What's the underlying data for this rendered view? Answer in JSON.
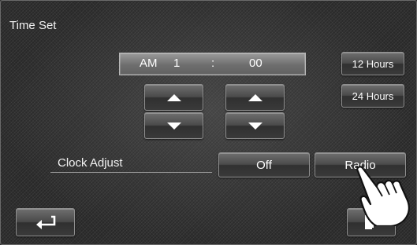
{
  "title": "Time Set",
  "time": {
    "ampm": "AM",
    "hour": "1",
    "separator": ":",
    "minute": "00"
  },
  "format_buttons": {
    "hours12": "12 Hours",
    "hours24": "24 Hours"
  },
  "clock_adjust": {
    "label": "Clock Adjust",
    "options": [
      "Off",
      "Radio"
    ],
    "selected": "Radio"
  },
  "icons": {
    "hour_up": "triangle-up-icon",
    "hour_down": "triangle-down-icon",
    "minute_up": "triangle-up-icon",
    "minute_down": "triangle-down-icon",
    "back": "return-arrow-icon",
    "exit": "exit-icon",
    "pointer": "hand-pointer-icon"
  }
}
